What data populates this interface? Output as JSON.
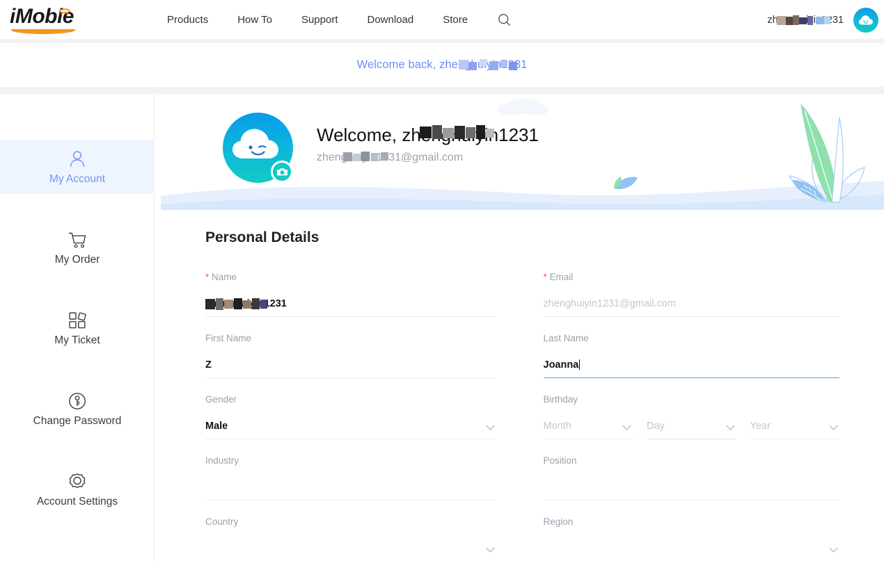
{
  "header": {
    "logo_text": "iMobie",
    "nav": [
      {
        "label": "Products"
      },
      {
        "label": "How To"
      },
      {
        "label": "Support"
      },
      {
        "label": "Download"
      },
      {
        "label": "Store"
      }
    ],
    "search_icon": "search-icon",
    "username": "zhenghuiyin1231",
    "avatar_icon": "cloud-avatar-icon"
  },
  "welcome_bar": {
    "text": "Welcome back, zhenghuiyin1231"
  },
  "sidebar": {
    "items": [
      {
        "label": "My Account",
        "icon": "user-icon",
        "active": true
      },
      {
        "label": "My Order",
        "icon": "shopping-cart-icon",
        "active": false
      },
      {
        "label": "My Ticket",
        "icon": "grid-tiles-icon",
        "active": false
      },
      {
        "label": "Change Password",
        "icon": "key-circle-icon",
        "active": false
      },
      {
        "label": "Account Settings",
        "icon": "gear-icon",
        "active": false
      }
    ]
  },
  "hero": {
    "greeting": "Welcome, zhenghuiyin1231",
    "email": "zhenghuiyin1231@gmail.com",
    "avatar_icon": "cloud-face-avatar-icon",
    "camera_badge_icon": "camera-icon"
  },
  "form": {
    "title": "Personal Details",
    "name": {
      "label": "Name",
      "required": true,
      "value": "zhenghuiyin1231"
    },
    "email": {
      "label": "Email",
      "required": true,
      "value": "zhenghuiyin1231@gmail.com"
    },
    "first_name": {
      "label": "First Name",
      "value": "Z"
    },
    "last_name": {
      "label": "Last Name",
      "value": "Joanna"
    },
    "gender": {
      "label": "Gender",
      "value": "Male"
    },
    "birthday": {
      "label": "Birthday",
      "month_placeholder": "Month",
      "day_placeholder": "Day",
      "year_placeholder": "Year",
      "month_value": "",
      "day_value": "",
      "year_value": ""
    },
    "industry": {
      "label": "Industry",
      "value": ""
    },
    "position": {
      "label": "Position",
      "value": ""
    },
    "country": {
      "label": "Country",
      "value": ""
    },
    "region": {
      "label": "Region",
      "value": ""
    }
  },
  "colors": {
    "brand_orange": "#F7941E",
    "link_blue": "#6f8df5",
    "active_blue": "#6f95f7",
    "active_bg": "#eff5fe",
    "required_red": "#f05a5a",
    "focus_underline": "#4a9ae8",
    "avatar_gradient_start": "#0a9bea",
    "avatar_gradient_end": "#10cbc2",
    "leaf_green": "#8fe0ae",
    "leaf_blue": "#9fc8f5"
  }
}
